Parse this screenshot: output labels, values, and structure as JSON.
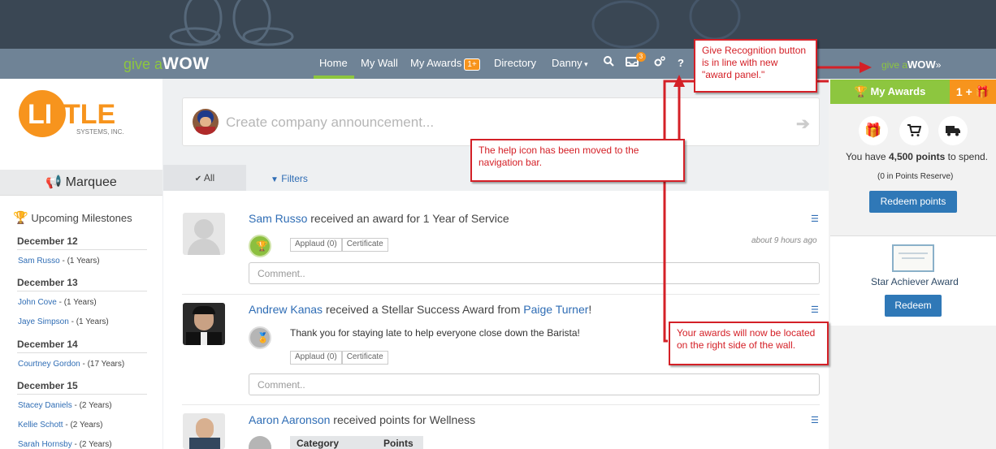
{
  "nav": {
    "logo_give": "give a",
    "logo_wow": "WOW",
    "items": [
      {
        "label": "Home"
      },
      {
        "label": "My Wall"
      },
      {
        "label": "My Awards"
      },
      {
        "label": "Directory"
      },
      {
        "label": "Danny"
      }
    ],
    "awards_badge": "1+",
    "inbox_count": "3",
    "help_symbol": "?",
    "accent": "#8dc63f"
  },
  "company": {
    "logo_text": "LITTLE",
    "logo_sub": "SYSTEMS, INC."
  },
  "marquee": {
    "label": "Marquee"
  },
  "milestones": {
    "title": "Upcoming Milestones",
    "groups": [
      {
        "date": "December 12",
        "people": [
          {
            "name": "Sam Russo",
            "years": " - (1 Years)"
          }
        ]
      },
      {
        "date": "December 13",
        "people": [
          {
            "name": "John Cove",
            "years": " - (1 Years)"
          },
          {
            "name": "Jaye Simpson",
            "years": " - (1 Years)"
          }
        ]
      },
      {
        "date": "December 14",
        "people": [
          {
            "name": "Courtney Gordon",
            "years": " - (17 Years)"
          }
        ]
      },
      {
        "date": "December 15",
        "people": [
          {
            "name": "Stacey Daniels",
            "years": " - (2 Years)"
          },
          {
            "name": "Kellie Schott",
            "years": " - (2 Years)"
          },
          {
            "name": "Sarah Hornsby",
            "years": " - (2 Years)"
          }
        ]
      }
    ]
  },
  "announce": {
    "placeholder": "Create company announcement..."
  },
  "tabs": {
    "all": "All",
    "filters": "Filters"
  },
  "feed": {
    "posts": [
      {
        "name": "Sam Russo",
        "text": " received an award for 1 Year of Service",
        "time": "about 9 hours ago",
        "applaud": "Applaud (0)",
        "certificate": "Certificate",
        "comment": "Comment.."
      },
      {
        "name": "Andrew Kanas",
        "text": " received a Stellar Success Award from ",
        "from": "Paige Turner",
        "tail": "!",
        "message": "Thank you for staying late to help everyone close down the Barista!",
        "applaud": "Applaud (0)",
        "certificate": "Certificate",
        "comment": "Comment.."
      },
      {
        "name": "Aaron Aaronson",
        "text": " received points for Wellness",
        "col1": "Category",
        "col2": "Points"
      }
    ]
  },
  "panel": {
    "giveawow_a": "give a",
    "giveawow_b": "WOW",
    "giveawow_arrow": "»",
    "title": "My Awards",
    "badge": "1 +",
    "points_prefix": "You have ",
    "points_value": "4,500 points",
    "points_suffix": " to spend.",
    "reserve": "(0 in Points Reserve)",
    "redeem_points": "Redeem points",
    "award_name": "Star Achiever Award",
    "redeem": "Redeem"
  },
  "callouts": {
    "give_recognition": "Give Recognition button is in line with new \"award panel.\"",
    "help_icon": "The help icon has been moved to the navigation bar.",
    "awards_location": "Your awards will now be located on the right side of the wall."
  }
}
